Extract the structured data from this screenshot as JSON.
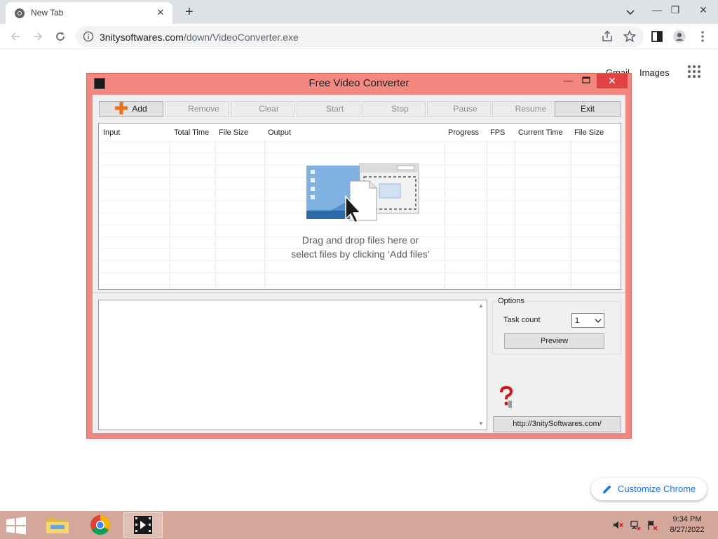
{
  "browser": {
    "tab_title": "New Tab",
    "tab_close": "✕",
    "new_tab": "+",
    "url_domain": "3nitysoftwares.com",
    "url_path": "/down/VideoConverter.exe",
    "window_controls": {
      "minimize": "—",
      "restore": "❐",
      "close": "✕"
    }
  },
  "newtab_page": {
    "gmail": "Gmail",
    "images": "Images",
    "customize_chrome": "Customize Chrome"
  },
  "app": {
    "title": "Free Video Converter",
    "controls": {
      "minimize": "—",
      "close": "✕"
    },
    "toolbar": {
      "add": "Add",
      "remove": "Remove",
      "clear": "Clear",
      "start": "Start",
      "stop": "Stop",
      "pause": "Pause",
      "resume": "Resume",
      "exit": "Exit"
    },
    "grid_columns": [
      "Input",
      "Total Time",
      "File Size",
      "Output",
      "Progress",
      "FPS",
      "Current Time",
      "File Size"
    ],
    "drop_hint_line1": "Drag and drop files here or",
    "drop_hint_line2": "select files by clicking ‘Add files’",
    "options": {
      "legend": "Options",
      "task_count_label": "Task count",
      "task_count_value": "1",
      "preview": "Preview"
    },
    "website_button": "http://3nitySoftwares.com/"
  },
  "taskbar": {
    "time": "9:34 PM",
    "date": "8/27/2022",
    "apps": [
      "file-explorer",
      "google-chrome",
      "free-video-converter"
    ]
  },
  "colors": {
    "app_frame": "#f38881",
    "app_close": "#e04343",
    "taskbar": "#d4a79b",
    "link_blue": "#1a73e8"
  }
}
